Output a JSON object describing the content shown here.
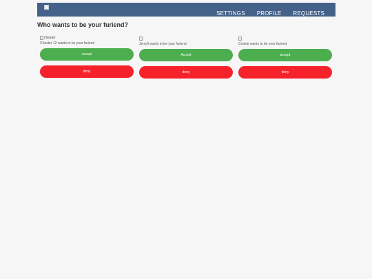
{
  "nav": {
    "links": [
      "SETTINGS",
      "PROFILE",
      "REQUESTS"
    ]
  },
  "page": {
    "title": "Who wants to be your furiend?"
  },
  "requests": [
    {
      "image_alt": "chester",
      "text": "Chester 12 wants to be your furiend",
      "accept_label": "accept",
      "deny_label": "deny"
    },
    {
      "image_alt": "",
      "text": "Jerry3 wants to be your furiend",
      "accept_label": "Accept",
      "deny_label": "deny"
    },
    {
      "image_alt": "",
      "text": "Cookie wants to be your furiend",
      "accept_label": "accept",
      "deny_label": "deny"
    }
  ],
  "colors": {
    "navbar": "#44618a",
    "accept": "#4cae4f",
    "deny": "#f5222b",
    "background": "#f6f6f7"
  }
}
